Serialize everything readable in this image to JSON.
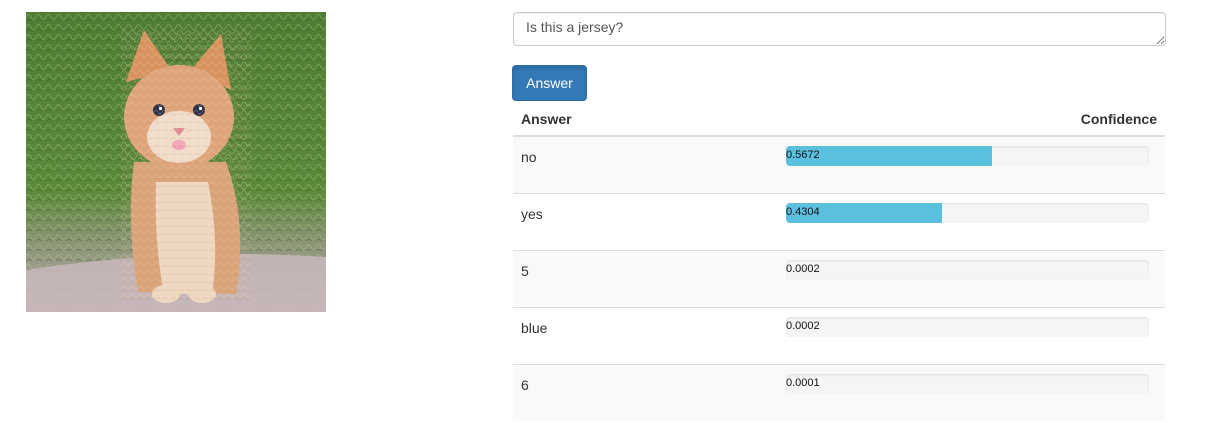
{
  "question": {
    "value": "Is this a jersey?"
  },
  "answer_button": {
    "label": "Answer",
    "color": "#337ab7"
  },
  "table": {
    "headers": {
      "answer": "Answer",
      "confidence": "Confidence"
    },
    "bar_color": "#5bc0de",
    "rows": [
      {
        "answer": "no",
        "confidence": 0.5672,
        "confidence_label": "0.5672"
      },
      {
        "answer": "yes",
        "confidence": 0.4304,
        "confidence_label": "0.4304"
      },
      {
        "answer": "5",
        "confidence": 0.0002,
        "confidence_label": "0.0002"
      },
      {
        "answer": "blue",
        "confidence": 0.0002,
        "confidence_label": "0.0002"
      },
      {
        "answer": "6",
        "confidence": 0.0001,
        "confidence_label": "0.0001"
      }
    ]
  }
}
